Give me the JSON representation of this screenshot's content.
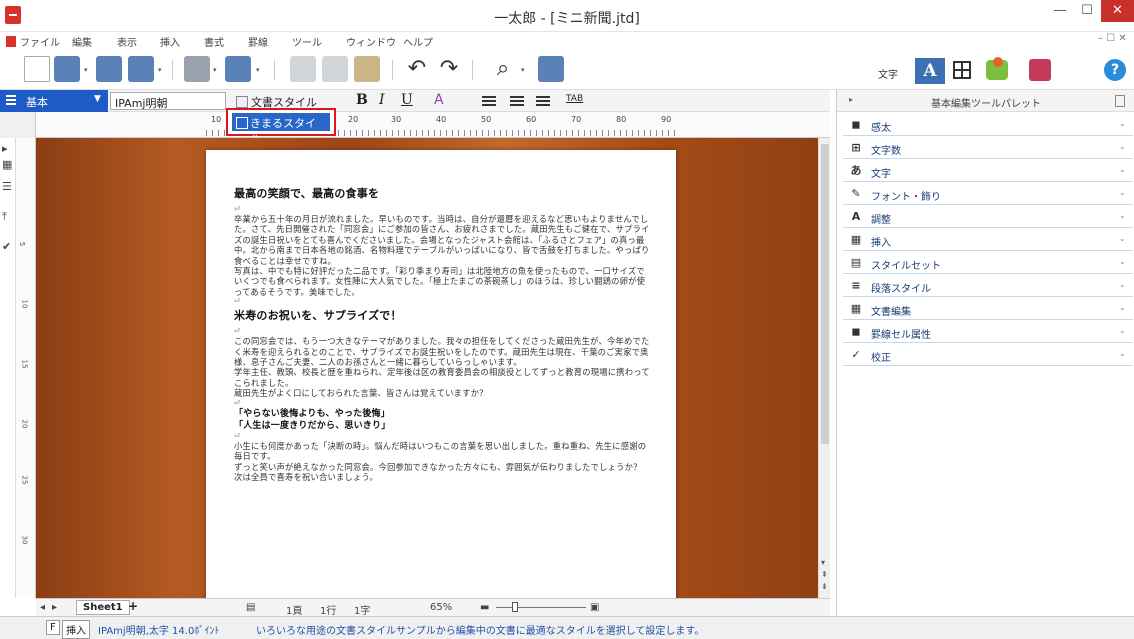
{
  "window": {
    "title": "一太郎 - [ミニ新聞.jtd]",
    "minimize": "—",
    "maximize": "☐",
    "close": "✕"
  },
  "menu": [
    "ファイル",
    "編集",
    "表示",
    "挿入",
    "書式",
    "罫線",
    "ツール",
    "ウィンドウ",
    "ヘルプ"
  ],
  "menu_right": "– ☐ ✕",
  "toolbar": {
    "mode_label": "文字",
    "mode_a": "A",
    "help": "?"
  },
  "format": {
    "style_name": "基本",
    "font_name": "IPAmj明朝",
    "doc_style_label": "文書スタイル",
    "bold": "B",
    "italic": "I",
    "underline": "U",
    "color": "A",
    "tab": "TAB"
  },
  "style_popup": {
    "label": "きまるスタイル"
  },
  "ruler": {
    "numbers": [
      "10",
      "20",
      "30",
      "40",
      "50",
      "60",
      "70",
      "80",
      "90"
    ]
  },
  "vruler": {
    "numbers": [
      "5",
      "10",
      "15",
      "20",
      "25",
      "30"
    ]
  },
  "document": {
    "heading1": "最高の笑顔で、最高の食事を",
    "para1": "卒業から五十年の月日が流れました。早いものです。当時は、自分が還暦を迎えるなど思いもよりませんでした。さて、先日開催された「同窓会」にご参加の皆さん、お疲れさまでした。蔵田先生もご健在で、サプライズの誕生日祝いをとても喜んでくださいました。会場となったジャスト会館は、「ふるさとフェア」の真っ最中。北から南まで日本各地の銘酒、名物料理でテーブルがいっぱいになり、皆で舌鼓を打ちました。やっぱり食べることは幸せですね。",
    "para2": "写真は、中でも特に好評だった二品です。「彩り季まり寿司」は北陸地方の魚を使ったもので、一口サイズでいくつでも食べられます。女性陣に大人気でした。「極上たまごの茶碗蒸し」のほうは、珍しい闘鶏の卵が使ってあるそうです。美味でした。",
    "heading2": "米寿のお祝いを、サプライズで！",
    "para3": "この同窓会では、もう一つ大きなテーマがありました。我々の担任をしてくださった蔵田先生が、今年めでたく米寿を迎えられるとのことで、サプライズでお誕生祝いをしたのです。蔵田先生は現在、千葉のご実家で奥様、息子さんご夫妻、二人のお孫さんと一緒に暮らしていらっしゃいます。",
    "para4": "学年主任、教頭、校長と歴を重ねられ、定年後は区の教育委員会の相談役としてずっと教育の現場に携わってこられました。",
    "para5": "蔵田先生がよく口にしておられた言葉、皆さんは覚えていますか？",
    "quote1": "「やらない後悔よりも、やった後悔」",
    "quote2": "「人生は一度きりだから、思いきり」",
    "para6": "小生にも何度かあった「決断の時」。悩んだ時はいつもこの言葉を思い出しました。重ね重ね、先生に感謝の毎日です。",
    "para7": "ずっと笑い声が絶えなかった同窓会。今回参加できなかった方々にも、雰囲気が伝わりましたでしょうか？　次は全員で喜寿を祝い合いましょう。"
  },
  "sheetbar": {
    "sheet": "Sheet1",
    "add": "+",
    "page": "1頁",
    "line": "1行",
    "char": "1字",
    "zoom": "65%"
  },
  "status": {
    "f": "F",
    "mode": "挿入",
    "font": "IPAmj明朝,太字 14.0ﾎﾟｲﾝﾄ",
    "hint": "いろいろな用途の文書スタイルサンプルから編集中の文書に最適なスタイルを選択して設定します。"
  },
  "palette": {
    "title": "基本編集ツールパレット",
    "items": [
      {
        "icon": "◼",
        "label": "感太"
      },
      {
        "icon": "⊞",
        "label": "文字数"
      },
      {
        "icon": "あ",
        "label": "文字"
      },
      {
        "icon": "✎",
        "label": "フォント・飾り"
      },
      {
        "icon": "A",
        "label": "調整"
      },
      {
        "icon": "▦",
        "label": "挿入"
      },
      {
        "icon": "▤",
        "label": "スタイルセット"
      },
      {
        "icon": "≡",
        "label": "段落スタイル"
      },
      {
        "icon": "▦",
        "label": "文書編集"
      },
      {
        "icon": "◼",
        "label": "罫線セル属性"
      },
      {
        "icon": "✓",
        "label": "校正"
      }
    ]
  }
}
